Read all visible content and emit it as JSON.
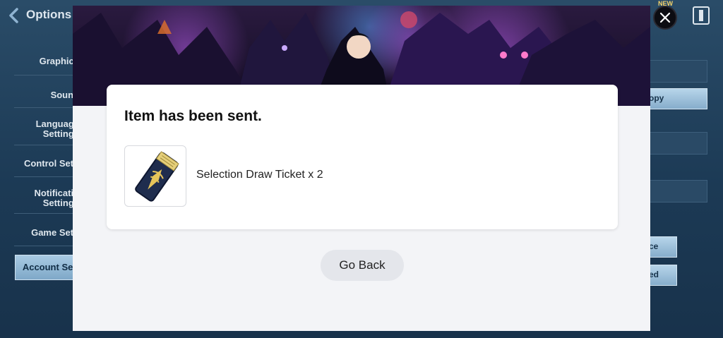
{
  "header": {
    "title": "Options",
    "new_badge": "NEW"
  },
  "menu": {
    "items": [
      {
        "label": "Graphics"
      },
      {
        "label": "Sound"
      },
      {
        "label": "Language\nSettings"
      },
      {
        "label": "Control Setti"
      },
      {
        "label": "Notificatio\nSettings"
      },
      {
        "label": "Game Setti"
      },
      {
        "label": "Account Sett"
      }
    ],
    "active_index": 6
  },
  "right_buttons": [
    "opy",
    "ce",
    "ed"
  ],
  "modal": {
    "title": "Item has been sent.",
    "item": {
      "name": "Selection Draw Ticket x 2",
      "icon": "ticket-icon"
    },
    "go_back_label": "Go Back"
  },
  "colors": {
    "accent": "#a9cbe4",
    "panel": "#f3f4f7",
    "background": "#1e3a52"
  }
}
